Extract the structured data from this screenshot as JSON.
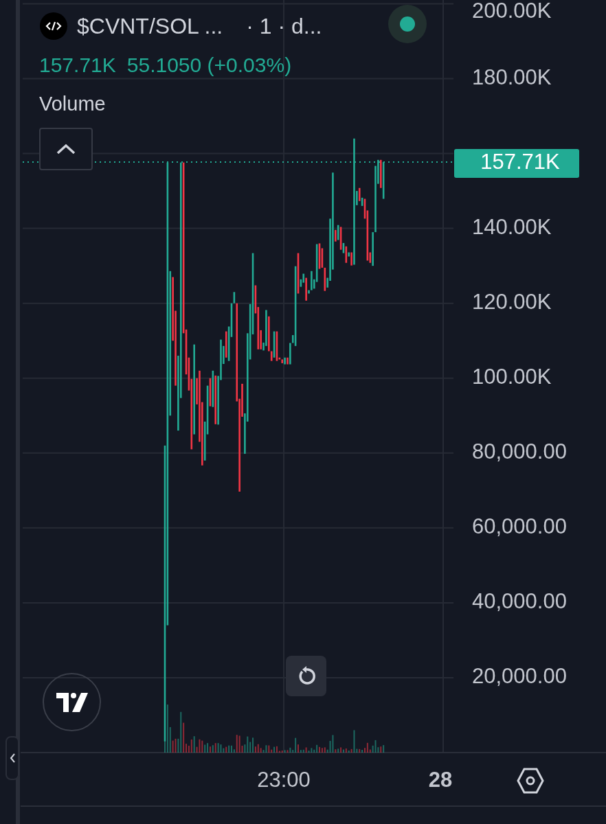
{
  "header": {
    "symbol": "$CVNT/SOL ...",
    "interval": "· 1 · d...",
    "price": "157.71K",
    "change": "55.1050 (+0.03%)"
  },
  "indicator": {
    "label": "Volume"
  },
  "chart": {
    "last_price_label": "157.71K",
    "y_axis_labels": [
      "200.00K",
      "180.00K",
      "140.00K",
      "120.00K",
      "100.00K",
      "80,000.00",
      "60,000.00",
      "40,000.00",
      "20,000.00"
    ],
    "x_axis_labels": [
      "23:00",
      "28"
    ]
  }
}
